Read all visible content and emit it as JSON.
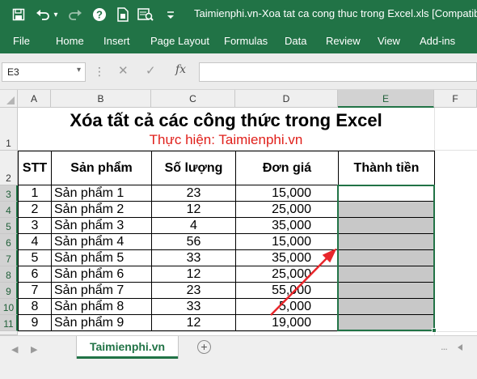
{
  "window": {
    "title": "Taimienphi.vn-Xoa tat ca cong thuc trong Excel.xls  [Compatibility"
  },
  "quick_access": [
    {
      "name": "save-icon",
      "glyph": "🖫"
    },
    {
      "name": "undo-icon",
      "glyph": "↶"
    },
    {
      "name": "undo-dropdown-icon",
      "glyph": "▾"
    },
    {
      "name": "redo-icon",
      "glyph": "↷"
    },
    {
      "name": "help-icon",
      "glyph": "?"
    },
    {
      "name": "new-file-icon",
      "glyph": "▤"
    },
    {
      "name": "print-preview-icon",
      "glyph": "⎙"
    },
    {
      "name": "customize-toolbar-icon",
      "glyph": "⇣"
    }
  ],
  "ribbon_tabs": [
    "File",
    "Home",
    "Insert",
    "Page Layout",
    "Formulas",
    "Data",
    "Review",
    "View",
    "Add-ins"
  ],
  "formula_bar": {
    "name_box": "E3",
    "cancel_glyph": "✕",
    "enter_glyph": "✓",
    "fx_label": "fx",
    "formula_value": ""
  },
  "columns": [
    "A",
    "B",
    "C",
    "D",
    "E",
    "F"
  ],
  "rows": [
    "1",
    "2",
    "3",
    "4",
    "5",
    "6",
    "7",
    "8",
    "9",
    "10",
    "11"
  ],
  "sheet": {
    "title": "Xóa tất cả các công thức trong Excel",
    "subtitle": "Thực hiện: Taimienphi.vn",
    "headers": [
      "STT",
      "Sản phẩm",
      "Số lượng",
      "Đơn giá",
      "Thành tiền"
    ],
    "rows": [
      {
        "stt": "1",
        "product": "Sản phẩm 1",
        "qty": "23",
        "price": "15,000",
        "total": ""
      },
      {
        "stt": "2",
        "product": "Sản phẩm 2",
        "qty": "12",
        "price": "25,000",
        "total": ""
      },
      {
        "stt": "3",
        "product": "Sản phẩm 3",
        "qty": "4",
        "price": "35,000",
        "total": ""
      },
      {
        "stt": "4",
        "product": "Sản phẩm 4",
        "qty": "56",
        "price": "15,000",
        "total": ""
      },
      {
        "stt": "5",
        "product": "Sản phẩm 5",
        "qty": "33",
        "price": "35,000",
        "total": ""
      },
      {
        "stt": "6",
        "product": "Sản phẩm 6",
        "qty": "12",
        "price": "25,000",
        "total": ""
      },
      {
        "stt": "7",
        "product": "Sản phẩm 7",
        "qty": "23",
        "price": "55,000",
        "total": ""
      },
      {
        "stt": "8",
        "product": "Sản phẩm 8",
        "qty": "33",
        "price": "5,000",
        "total": ""
      },
      {
        "stt": "9",
        "product": "Sản phẩm 9",
        "qty": "12",
        "price": "19,000",
        "total": ""
      }
    ]
  },
  "sheet_tabs": {
    "active": "Taimienphi.vn",
    "add_label": "+",
    "more_label": "..."
  },
  "colors": {
    "excel_green": "#217346",
    "subtitle_red": "#e0201b",
    "selected_fill": "#c8c8c8",
    "arrow_red": "#e8262b"
  }
}
